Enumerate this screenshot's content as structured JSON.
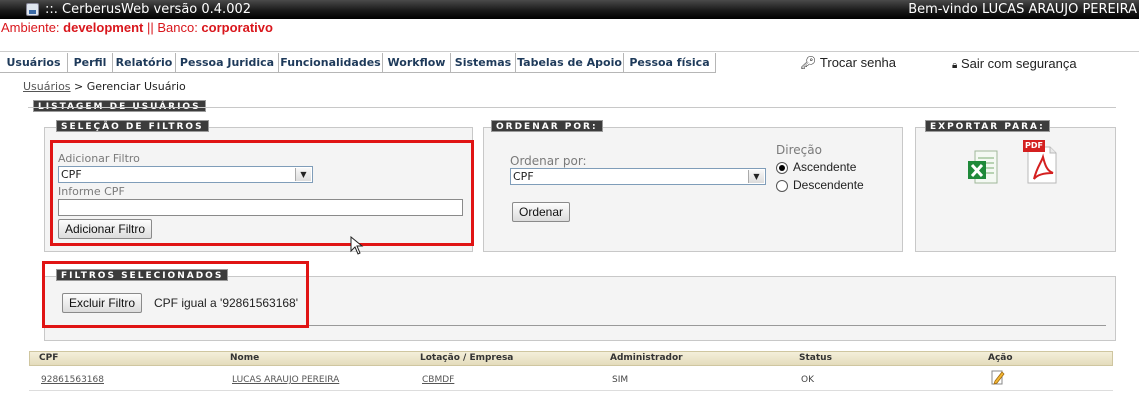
{
  "window": {
    "title": "::. CerberusWeb versão 0.4.002",
    "welcome": "Bem-vindo LUCAS ARAUJO PEREIRA"
  },
  "env": {
    "ambiente_label": "Ambiente: ",
    "ambiente_value": "development",
    "separator": " || ",
    "banco_label": "Banco: ",
    "banco_value": "corporativo"
  },
  "menu": {
    "items": [
      "Usuários",
      "Perfil",
      "Relatório",
      "Pessoa Juridica",
      "Funcionalidades",
      "Workflow",
      "Sistemas",
      "Tabelas de Apoio",
      "Pessoa física"
    ],
    "trocar_senha": "Trocar senha",
    "sair": "Sair com segurança"
  },
  "breadcrumb": {
    "link": "Usuários",
    "separator": " > ",
    "current": "Gerenciar Usuário"
  },
  "listagem": {
    "title": "LISTAGEM DE USUÁRIOS"
  },
  "filtros": {
    "title": "SELEÇÃO DE FILTROS",
    "adicionar_label": "Adicionar Filtro",
    "selected_filter": "CPF",
    "informe_label": "Informe CPF",
    "cpf_input_value": "",
    "add_button": "Adicionar Filtro"
  },
  "ordenar": {
    "title": "ORDENAR POR:",
    "label": "Ordenar por:",
    "selected": "CPF",
    "direcao_label": "Direção",
    "asc": "Ascendente",
    "desc": "Descendente",
    "button": "Ordenar"
  },
  "exportar": {
    "title": "EXPORTAR PARA:",
    "pdf_badge": "PDF"
  },
  "selecionados": {
    "title": "FILTROS SELECIONADOS",
    "remove_button": "Excluir Filtro",
    "filter_text": "CPF igual a '92861563168'"
  },
  "table": {
    "headers": [
      "CPF",
      "Nome",
      "Lotação / Empresa",
      "Administrador",
      "Status",
      "Ação"
    ],
    "rows": [
      [
        "92861563168",
        "LUCAS ARAUJO PEREIRA",
        "CBMDF",
        "SIM",
        "OK"
      ]
    ]
  },
  "colors": {
    "accent_red": "#e01414",
    "env_red": "#d9161c",
    "menu_text": "#1e3a5a"
  }
}
